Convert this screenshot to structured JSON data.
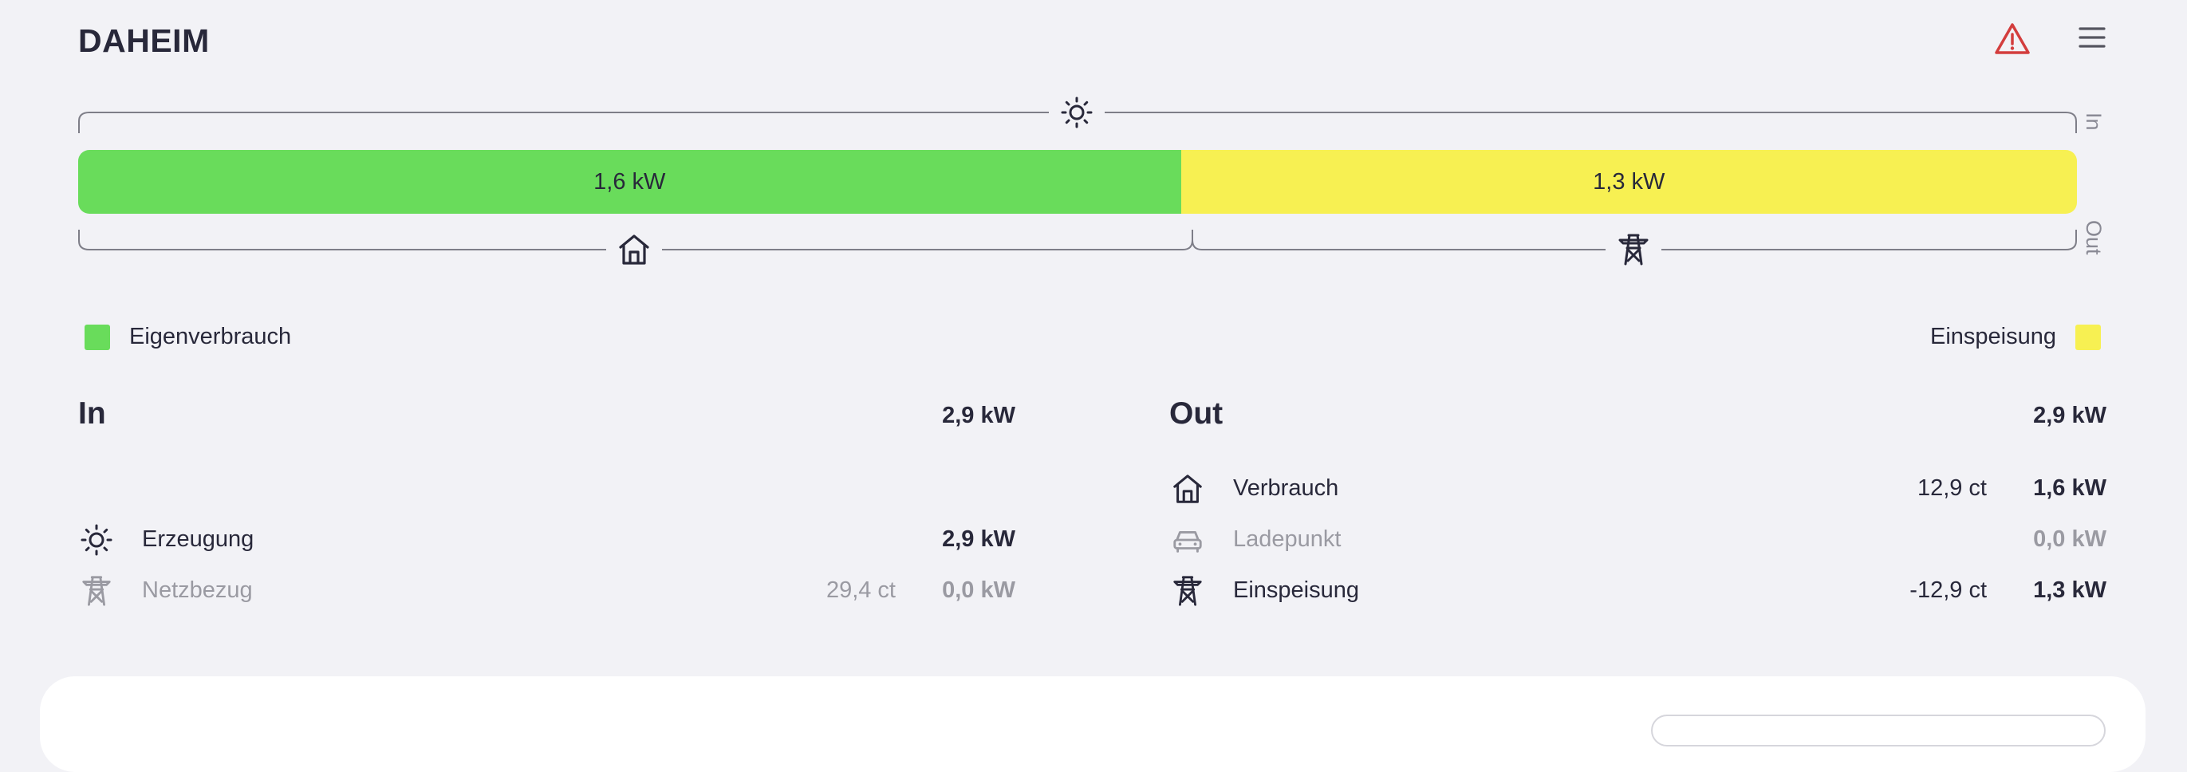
{
  "header": {
    "title": "DAHEIM"
  },
  "icons": {
    "warning": "warning-triangle-icon",
    "menu": "hamburger-menu-icon",
    "sun": "sun-icon",
    "home": "home-icon",
    "grid": "power-tower-icon",
    "car": "car-icon"
  },
  "colors": {
    "self_consumption": "#69dc5b",
    "feed_in": "#f7f052",
    "warning": "#d33d3d"
  },
  "energy_bar": {
    "side_in": "In",
    "side_out": "Out",
    "segments": [
      {
        "label": "1,6 kW",
        "value_kw": 1.6
      },
      {
        "label": "1,3 kW",
        "value_kw": 1.3
      }
    ]
  },
  "legend": {
    "self_consumption": "Eigenverbrauch",
    "feed_in": "Einspeisung"
  },
  "in": {
    "title": "In",
    "total": "2,9 kW",
    "rows": [
      {
        "label": "Erzeugung",
        "price": "",
        "power": "2,9 kW"
      },
      {
        "label": "Netzbezug",
        "price": "29,4 ct",
        "power": "0,0 kW"
      }
    ]
  },
  "out": {
    "title": "Out",
    "total": "2,9 kW",
    "rows": [
      {
        "label": "Verbrauch",
        "price": "12,9 ct",
        "power": "1,6 kW"
      },
      {
        "label": "Ladepunkt",
        "price": "",
        "power": "0,0 kW"
      },
      {
        "label": "Einspeisung",
        "price": "-12,9 ct",
        "power": "1,3 kW"
      }
    ]
  }
}
